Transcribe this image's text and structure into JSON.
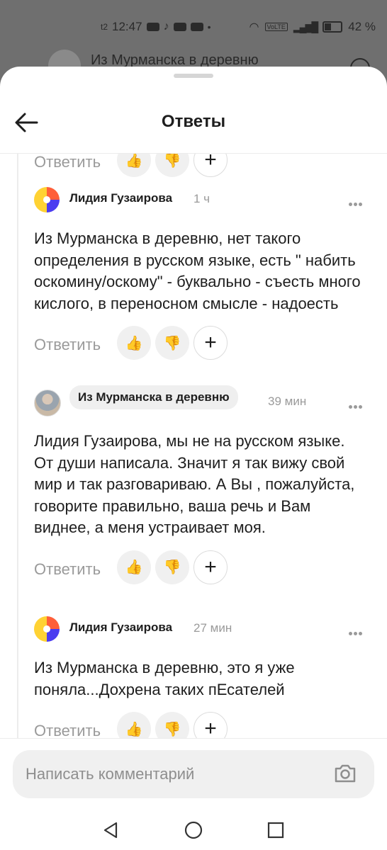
{
  "status_bar": {
    "carrier_tag": "t2",
    "time": "12:47",
    "network_label": "VoLTE",
    "battery": "42 %"
  },
  "background_header": {
    "title": "Из Мурманска в деревню"
  },
  "sheet": {
    "title": "Ответы"
  },
  "partial_action": {
    "reply_label": "Ответить"
  },
  "comments": [
    {
      "author": "Лидия Гузаирова",
      "time": "1 ч",
      "text": "Из Мурманска в деревню, нет такого определения в русском языке, есть \" набить оскомину/оскому\" - буквально - съесть много кислого, в переносном смысле - надоесть",
      "reply_label": "Ответить"
    },
    {
      "author": "Из Мурманска в деревню",
      "time": "39 мин",
      "text": "Лидия Гузаирова, мы не на русском языке. От души написала. Значит я так вижу свой мир и так разговариваю. А Вы , пожалуйста, говорите правильно, ваша речь и Вам виднее, а меня устраивает моя.",
      "reply_label": "Ответить"
    },
    {
      "author": "Лидия Гузаирова",
      "time": "27 мин",
      "text": "Из Мурманска в деревню, это я уже поняла...Дохрена таких пЕсателей",
      "reply_label": "Ответить"
    }
  ],
  "input": {
    "placeholder": "Написать комментарий"
  },
  "icons": {
    "like": "thumbs-up-emoji",
    "dislike": "thumbs-down-emoji",
    "add_reaction": "plus-icon",
    "camera": "camera-icon"
  },
  "colors": {
    "muted_text": "#9a9a9a",
    "reaction_bg": "#f0f0f0",
    "input_bg": "#f0f0f0"
  }
}
